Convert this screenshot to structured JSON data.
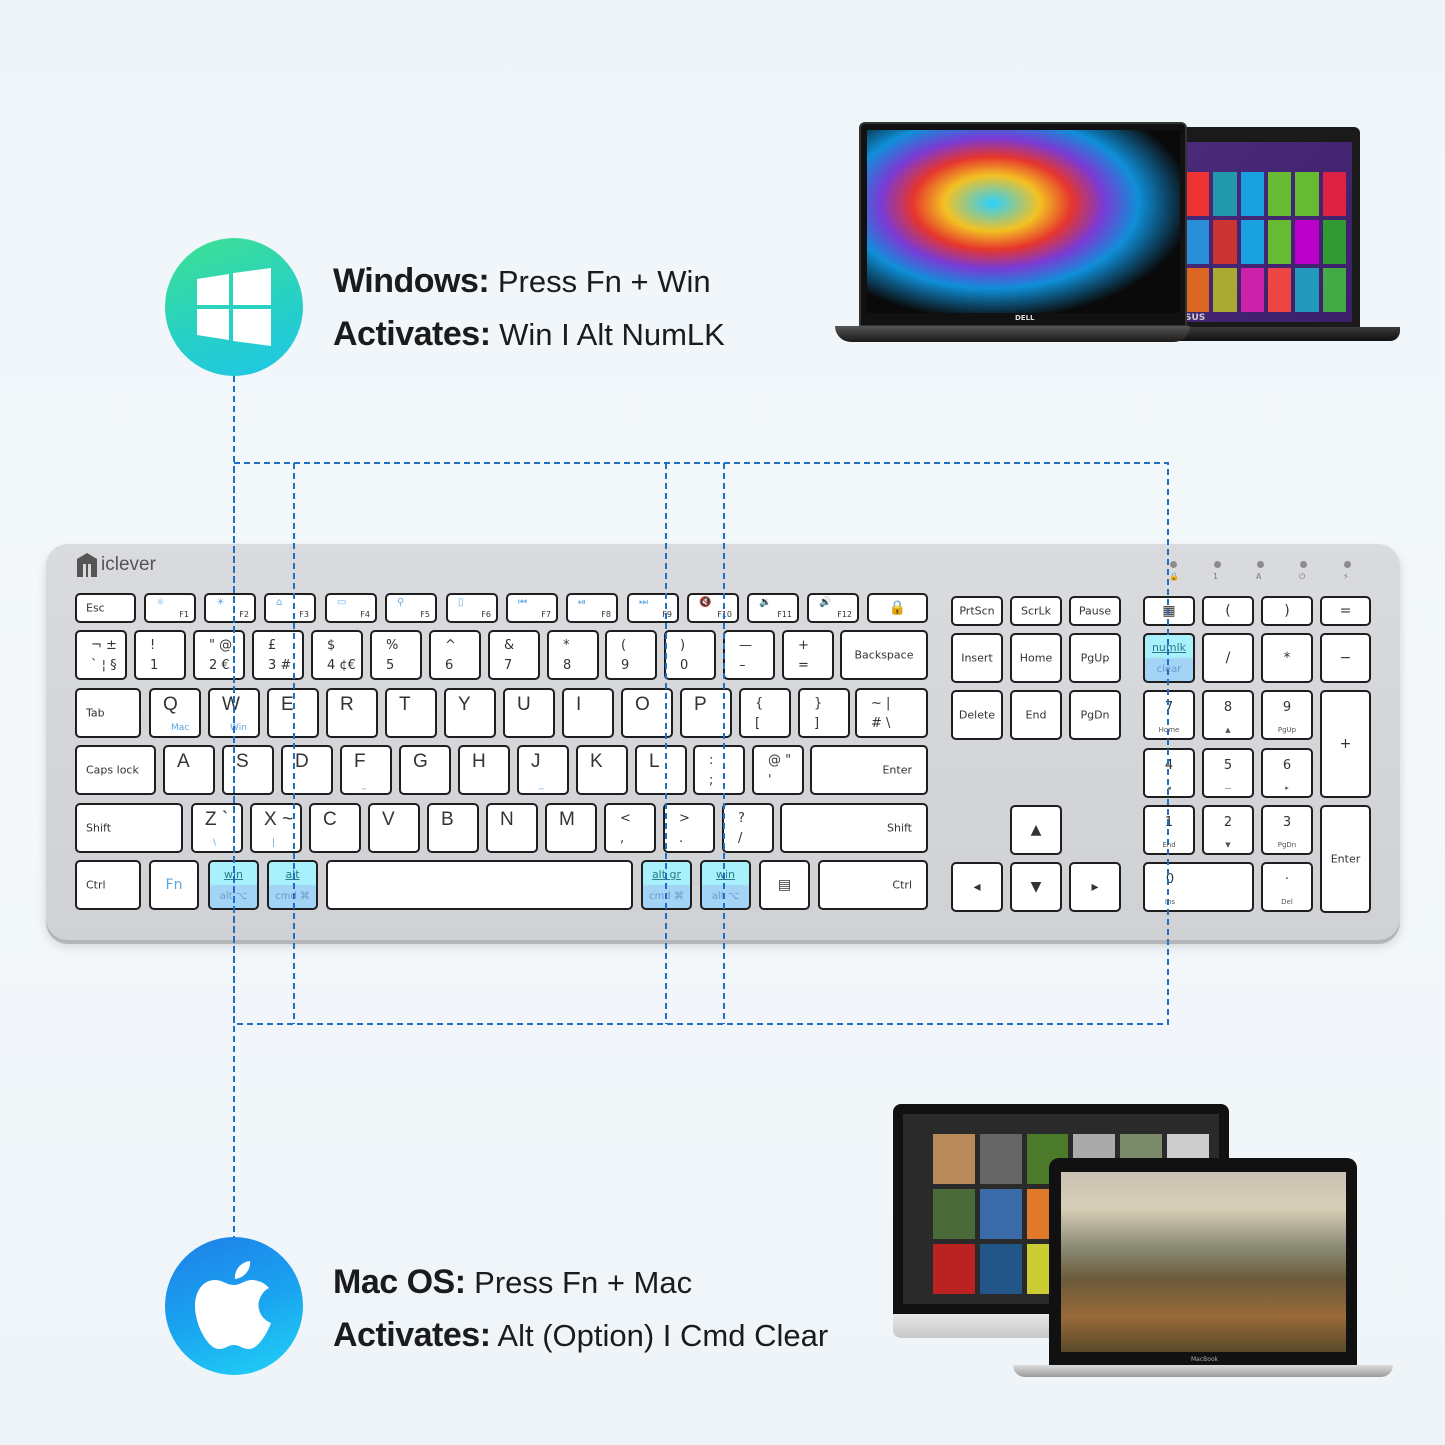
{
  "windows": {
    "label": "Windows:",
    "action": "Press Fn + Win",
    "activates_label": "Activates:",
    "activates": "Win I Alt NumLK",
    "icon": "windows-logo-icon",
    "color": "#2dd6b5"
  },
  "mac": {
    "label": "Mac OS:",
    "action": "Press Fn + Mac",
    "activates_label": "Activates:",
    "activates": "Alt (Option) I Cmd  Clear",
    "icon": "apple-logo-icon",
    "color": "#1a9ef0"
  },
  "brand": "iclever",
  "laptops": {
    "dell_brand": "DELL",
    "asus_brand": "SUS",
    "macbook_brand": "MacBook"
  },
  "indicators": [
    "lock",
    "1",
    "A",
    "power",
    "charge"
  ],
  "highlight_color": "#a8f0fb",
  "keys": [
    {
      "n": "esc",
      "t": "Esc"
    },
    {
      "n": "f1",
      "t": "☼",
      "b": "F1"
    },
    {
      "n": "f2",
      "t": "☀",
      "b": "F2"
    },
    {
      "n": "f3",
      "t": "⌂",
      "b": "F3"
    },
    {
      "n": "f4",
      "t": "▭",
      "b": "F4"
    },
    {
      "n": "f5",
      "t": "⚲",
      "b": "F5"
    },
    {
      "n": "f6",
      "t": "▯",
      "b": "F6"
    },
    {
      "n": "f7",
      "t": "⏮",
      "b": "F7"
    },
    {
      "n": "f8",
      "t": "⏯",
      "b": "F8"
    },
    {
      "n": "f9",
      "t": "⏭",
      "b": "F9"
    },
    {
      "n": "f10",
      "t": "🔇",
      "b": "F10"
    },
    {
      "n": "f11",
      "t": "🔉",
      "b": "F11"
    },
    {
      "n": "f12",
      "t": "🔊",
      "b": "F12"
    },
    {
      "n": "fn-lock",
      "t": "🔒"
    },
    {
      "n": "prtscn",
      "t": "PrtScn"
    },
    {
      "n": "scrlk",
      "t": "ScrLk"
    },
    {
      "n": "pause",
      "t": "Pause"
    },
    {
      "n": "calculator",
      "t": "▦"
    },
    {
      "n": "num-lparen",
      "t": "("
    },
    {
      "n": "num-rparen",
      "t": ")"
    },
    {
      "n": "num-equals",
      "t": "="
    },
    {
      "n": "backtick",
      "t": "¬  ±",
      "b": "` ¦ §"
    },
    {
      "n": "1",
      "t": "!",
      "b": "1"
    },
    {
      "n": "2",
      "t": "\"  @",
      "b": "2  €"
    },
    {
      "n": "3",
      "t": "£",
      "b": "3  #"
    },
    {
      "n": "4",
      "t": "$",
      "b": "4 ¢€"
    },
    {
      "n": "5",
      "t": "%",
      "b": "5"
    },
    {
      "n": "6",
      "t": "^",
      "b": "6"
    },
    {
      "n": "7",
      "t": "&",
      "b": "7"
    },
    {
      "n": "8",
      "t": "*",
      "b": "8"
    },
    {
      "n": "9",
      "t": "(",
      "b": "9"
    },
    {
      "n": "0",
      "t": ")",
      "b": "0"
    },
    {
      "n": "minus",
      "t": "—",
      "b": "–"
    },
    {
      "n": "equals",
      "t": "+",
      "b": "="
    },
    {
      "n": "backspace",
      "t": "Backspace"
    },
    {
      "n": "insert",
      "t": "Insert"
    },
    {
      "n": "home",
      "t": "Home"
    },
    {
      "n": "pgup",
      "t": "PgUp"
    },
    {
      "n": "numlk",
      "t": "numlk",
      "b": "clear"
    },
    {
      "n": "num-slash",
      "t": "/"
    },
    {
      "n": "num-star",
      "t": "*"
    },
    {
      "n": "num-minus",
      "t": "−"
    },
    {
      "n": "tab",
      "t": "Tab"
    },
    {
      "n": "q",
      "t": "Q",
      "b": "Mac"
    },
    {
      "n": "w",
      "t": "W",
      "b": "Win"
    },
    {
      "n": "e",
      "t": "E"
    },
    {
      "n": "r",
      "t": "R"
    },
    {
      "n": "t",
      "t": "T"
    },
    {
      "n": "y",
      "t": "Y"
    },
    {
      "n": "u",
      "t": "U"
    },
    {
      "n": "i",
      "t": "I"
    },
    {
      "n": "o",
      "t": "O"
    },
    {
      "n": "p",
      "t": "P"
    },
    {
      "n": "lbracket",
      "t": "{",
      "b": "["
    },
    {
      "n": "rbracket",
      "t": "}",
      "b": "]"
    },
    {
      "n": "hash",
      "t": "~   |",
      "b": "#   \\"
    },
    {
      "n": "delete",
      "t": "Delete"
    },
    {
      "n": "end",
      "t": "End"
    },
    {
      "n": "pgdn",
      "t": "PgDn"
    },
    {
      "n": "num7",
      "t": "7",
      "b": "Home"
    },
    {
      "n": "num8",
      "t": "8",
      "b": "▲"
    },
    {
      "n": "num9",
      "t": "9",
      "b": "PgUp"
    },
    {
      "n": "num-plus",
      "t": "+"
    },
    {
      "n": "caps-lock",
      "t": "Caps lock"
    },
    {
      "n": "a",
      "t": "A"
    },
    {
      "n": "s",
      "t": "S"
    },
    {
      "n": "d",
      "t": "D"
    },
    {
      "n": "f",
      "t": "F",
      "b": "_"
    },
    {
      "n": "g",
      "t": "G"
    },
    {
      "n": "h",
      "t": "H"
    },
    {
      "n": "j",
      "t": "J",
      "b": "_"
    },
    {
      "n": "k",
      "t": "K"
    },
    {
      "n": "l",
      "t": "L"
    },
    {
      "n": "semicolon",
      "t": ":",
      "b": ";"
    },
    {
      "n": "quote",
      "t": "@  \"",
      "b": "'"
    },
    {
      "n": "enter",
      "t": "Enter"
    },
    {
      "n": "num4",
      "t": "4",
      "b": "◂"
    },
    {
      "n": "num5",
      "t": "5",
      "b": "—"
    },
    {
      "n": "num6",
      "t": "6",
      "b": "▸"
    },
    {
      "n": "left-shift",
      "t": "Shift"
    },
    {
      "n": "z",
      "t": "Z  `",
      "b": "\\"
    },
    {
      "n": "x",
      "t": "X  ~",
      "b": "|"
    },
    {
      "n": "c",
      "t": "C"
    },
    {
      "n": "v",
      "t": "V"
    },
    {
      "n": "b",
      "t": "B"
    },
    {
      "n": "n",
      "t": "N"
    },
    {
      "n": "m",
      "t": "M"
    },
    {
      "n": "comma",
      "t": "<",
      "b": ","
    },
    {
      "n": "period",
      "t": ">",
      "b": "."
    },
    {
      "n": "slash",
      "t": "?",
      "b": "/"
    },
    {
      "n": "right-shift",
      "t": "Shift"
    },
    {
      "n": "arrow-up",
      "t": "▲"
    },
    {
      "n": "num1",
      "t": "1",
      "b": "End"
    },
    {
      "n": "num2",
      "t": "2",
      "b": "▼"
    },
    {
      "n": "num3",
      "t": "3",
      "b": "PgDn"
    },
    {
      "n": "num-enter",
      "t": "Enter"
    },
    {
      "n": "left-ctrl",
      "t": "Ctrl"
    },
    {
      "n": "fn",
      "t": "Fn"
    },
    {
      "n": "left-win",
      "t": "win",
      "b": "alt ⌥"
    },
    {
      "n": "left-alt",
      "t": "alt",
      "b": "cmd ⌘"
    },
    {
      "n": "space",
      "t": ""
    },
    {
      "n": "alt-gr",
      "t": "alt gr",
      "b": "cmd ⌘"
    },
    {
      "n": "right-win",
      "t": "win",
      "b": "alt ⌥"
    },
    {
      "n": "menu",
      "t": "▤"
    },
    {
      "n": "right-ctrl",
      "t": "Ctrl"
    },
    {
      "n": "arrow-left",
      "t": "◂"
    },
    {
      "n": "arrow-down",
      "t": "▼"
    },
    {
      "n": "arrow-right",
      "t": "▸"
    },
    {
      "n": "num0",
      "t": "0",
      "b": "Ins"
    },
    {
      "n": "num-dot",
      "t": "·",
      "b": "Del"
    }
  ]
}
